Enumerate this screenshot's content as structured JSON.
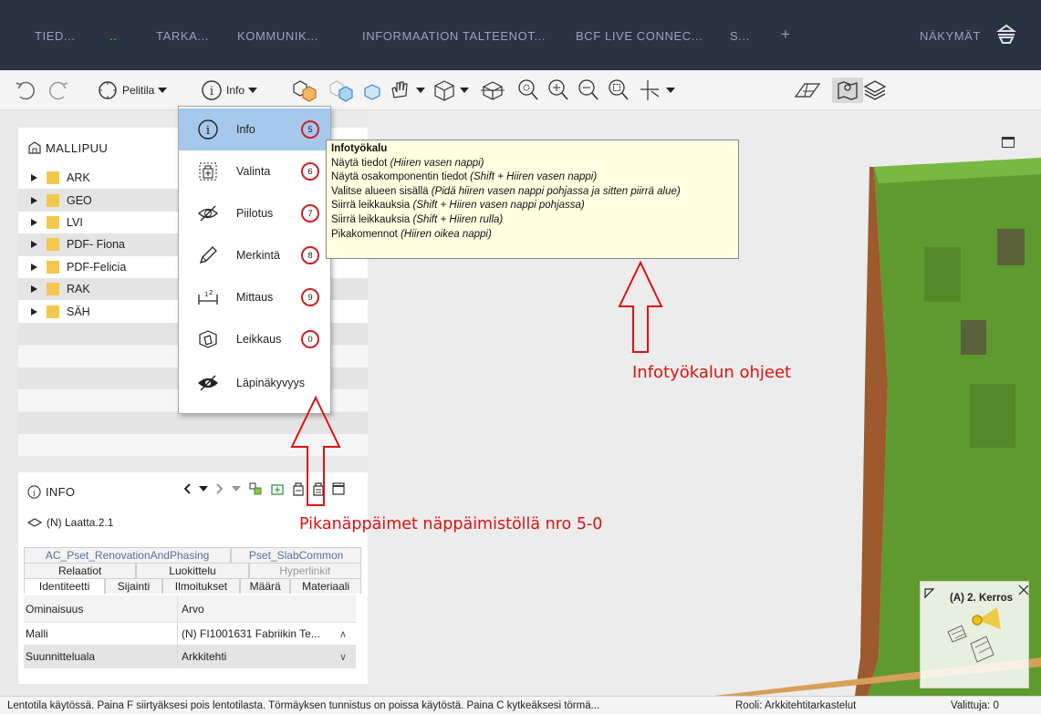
{
  "top_tabs": [
    {
      "label": "TIED...",
      "active": false
    },
    {
      "label": "..",
      "active": true
    },
    {
      "label": "TARKA...",
      "active": false
    },
    {
      "label": "KOMMUNIK...",
      "active": false
    },
    {
      "label": "INFORMAATION TALTEENOT...",
      "active": false
    },
    {
      "label": "BCF LIVE CONNEC...",
      "active": false
    },
    {
      "label": "S...",
      "active": false
    }
  ],
  "top_plus": "+",
  "views_label": "NÄKYMÄT",
  "toolbar": {
    "play_mode_label": "Pelitila",
    "info_label": "Info"
  },
  "model_tree": {
    "title": "MALLIPUU",
    "items": [
      "ARK",
      "GEO",
      "LVI",
      "PDF- Fiona",
      "PDF-Felicia",
      "RAK",
      "SÄH"
    ]
  },
  "tool_menu": {
    "items": [
      {
        "label": "Info",
        "key": "5",
        "icon": "info-icon",
        "selected": true
      },
      {
        "label": "Valinta",
        "key": "6",
        "icon": "selection-icon",
        "selected": false
      },
      {
        "label": "Piilotus",
        "key": "7",
        "icon": "hide-icon",
        "selected": false
      },
      {
        "label": "Merkintä",
        "key": "8",
        "icon": "pencil-icon",
        "selected": false
      },
      {
        "label": "Mittaus",
        "key": "9",
        "icon": "measure-icon",
        "selected": false
      },
      {
        "label": "Leikkaus",
        "key": "0",
        "icon": "section-box-icon",
        "selected": false
      },
      {
        "label": "Läpinäkyvyys",
        "key": "",
        "icon": "transparency-icon",
        "selected": false
      }
    ]
  },
  "tooltip": {
    "title": "Infotyökalu",
    "lines": [
      {
        "text": "Näytä tiedot ",
        "hint": "(Hiiren vasen nappi)"
      },
      {
        "text": "Näytä osakomponentin tiedot ",
        "hint": "(Shift + Hiiren vasen nappi)"
      },
      {
        "text": "Valitse alueen sisällä ",
        "hint": "(Pidä hiiren vasen nappi pohjassa ja sitten piirrä alue)"
      },
      {
        "text": "Siirrä leikkauksia ",
        "hint": "(Shift + Hiiren vasen nappi pohjassa)"
      },
      {
        "text": "Siirrä leikkauksia ",
        "hint": "(Shift + Hiiren rulla)"
      },
      {
        "text": "Pikakomennot ",
        "hint": "(Hiiren oikea nappi)"
      }
    ]
  },
  "info_panel": {
    "title": "INFO",
    "object_name": "(N) Laatta.2.1",
    "tab_rows": [
      [
        {
          "label": "AC_Pset_RenovationAndPhasing",
          "style": "link"
        },
        {
          "label": "Pset_SlabCommon",
          "style": "link"
        }
      ],
      [
        {
          "label": "Relaatiot",
          "style": "normal"
        },
        {
          "label": "Luokittelu",
          "style": "normal"
        },
        {
          "label": "Hyperlinkit",
          "style": "dim"
        }
      ],
      [
        {
          "label": "Identiteetti",
          "style": "sel"
        },
        {
          "label": "Sijainti",
          "style": "normal"
        },
        {
          "label": "Ilmoitukset",
          "style": "normal"
        },
        {
          "label": "Määrä",
          "style": "normal"
        },
        {
          "label": "Materiaali",
          "style": "normal"
        }
      ]
    ],
    "table_headers": [
      "Ominaisuus",
      "Arvo"
    ],
    "table_rows": [
      [
        "Malli",
        "(N) FI1001631 Fabriikin Te..."
      ],
      [
        "Suunnitteluala",
        "Arkkitehti"
      ]
    ]
  },
  "annotations": {
    "tooltip_note": "Infotyökalun ohjeet",
    "shortcut_note": "Pikanäppäimet näppäimistöllä nro 5-0",
    "color": "#dd1111"
  },
  "minimap": {
    "label": "(A) 2. Kerros"
  },
  "statusbar": {
    "message": "Lentotila käytössä. Paina F siirtyäksesi pois lentotilasta. Törmäyksen tunnistus on poissa käytöstä. Paina C kytkeäksesi törmä...",
    "role": "Rooli: Arkkitehtitarkastelut",
    "selected": "Valittuja: 0"
  }
}
